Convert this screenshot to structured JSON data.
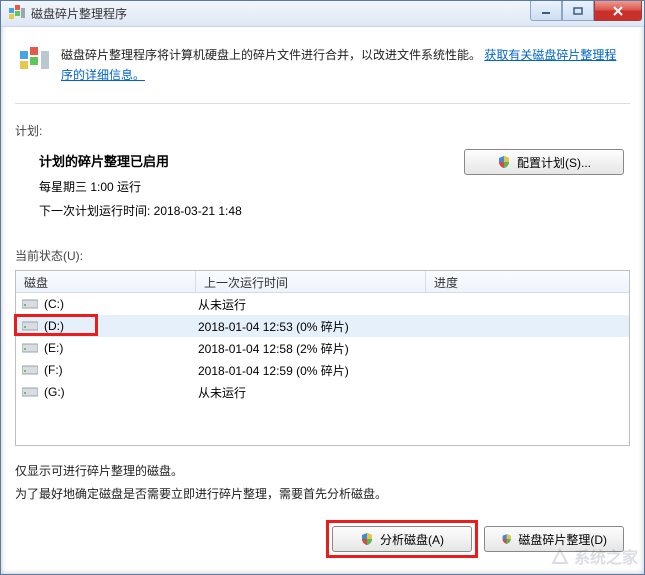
{
  "window": {
    "title": "磁盘碎片整理程序"
  },
  "intro": {
    "text_before_link": "磁盘碎片整理程序将计算机硬盘上的碎片文件进行合并，以改进文件系统性能。",
    "link_text": "获取有关磁盘碎片整理程序的详细信息。"
  },
  "labels": {
    "schedule_section": "计划:",
    "status_section": "当前状态(U):"
  },
  "plan": {
    "title": "计划的碎片整理已启用",
    "schedule_line": "每星期三 1:00 运行",
    "next_run_line": "下一次计划运行时间: 2018-03-21 1:48"
  },
  "buttons": {
    "configure": "配置计划(S)...",
    "analyze": "分析磁盘(A)",
    "defrag": "磁盘碎片整理(D)"
  },
  "table": {
    "headers": {
      "disk": "磁盘",
      "last_run": "上一次运行时间",
      "progress": "进度"
    },
    "rows": [
      {
        "drive": "(C:)",
        "last_run": "从未运行",
        "selected": false
      },
      {
        "drive": "(D:)",
        "last_run": "2018-01-04 12:53 (0% 碎片)",
        "selected": true
      },
      {
        "drive": "(E:)",
        "last_run": "2018-01-04 12:58 (2% 碎片)",
        "selected": false
      },
      {
        "drive": "(F:)",
        "last_run": "2018-01-04 12:59 (0% 碎片)",
        "selected": false
      },
      {
        "drive": "(G:)",
        "last_run": "从未运行",
        "selected": false
      }
    ]
  },
  "footnote": {
    "line1": "仅显示可进行碎片整理的磁盘。",
    "line2": "为了最好地确定磁盘是否需要立即进行碎片整理，需要首先分析磁盘。"
  },
  "watermark": "系统之家"
}
